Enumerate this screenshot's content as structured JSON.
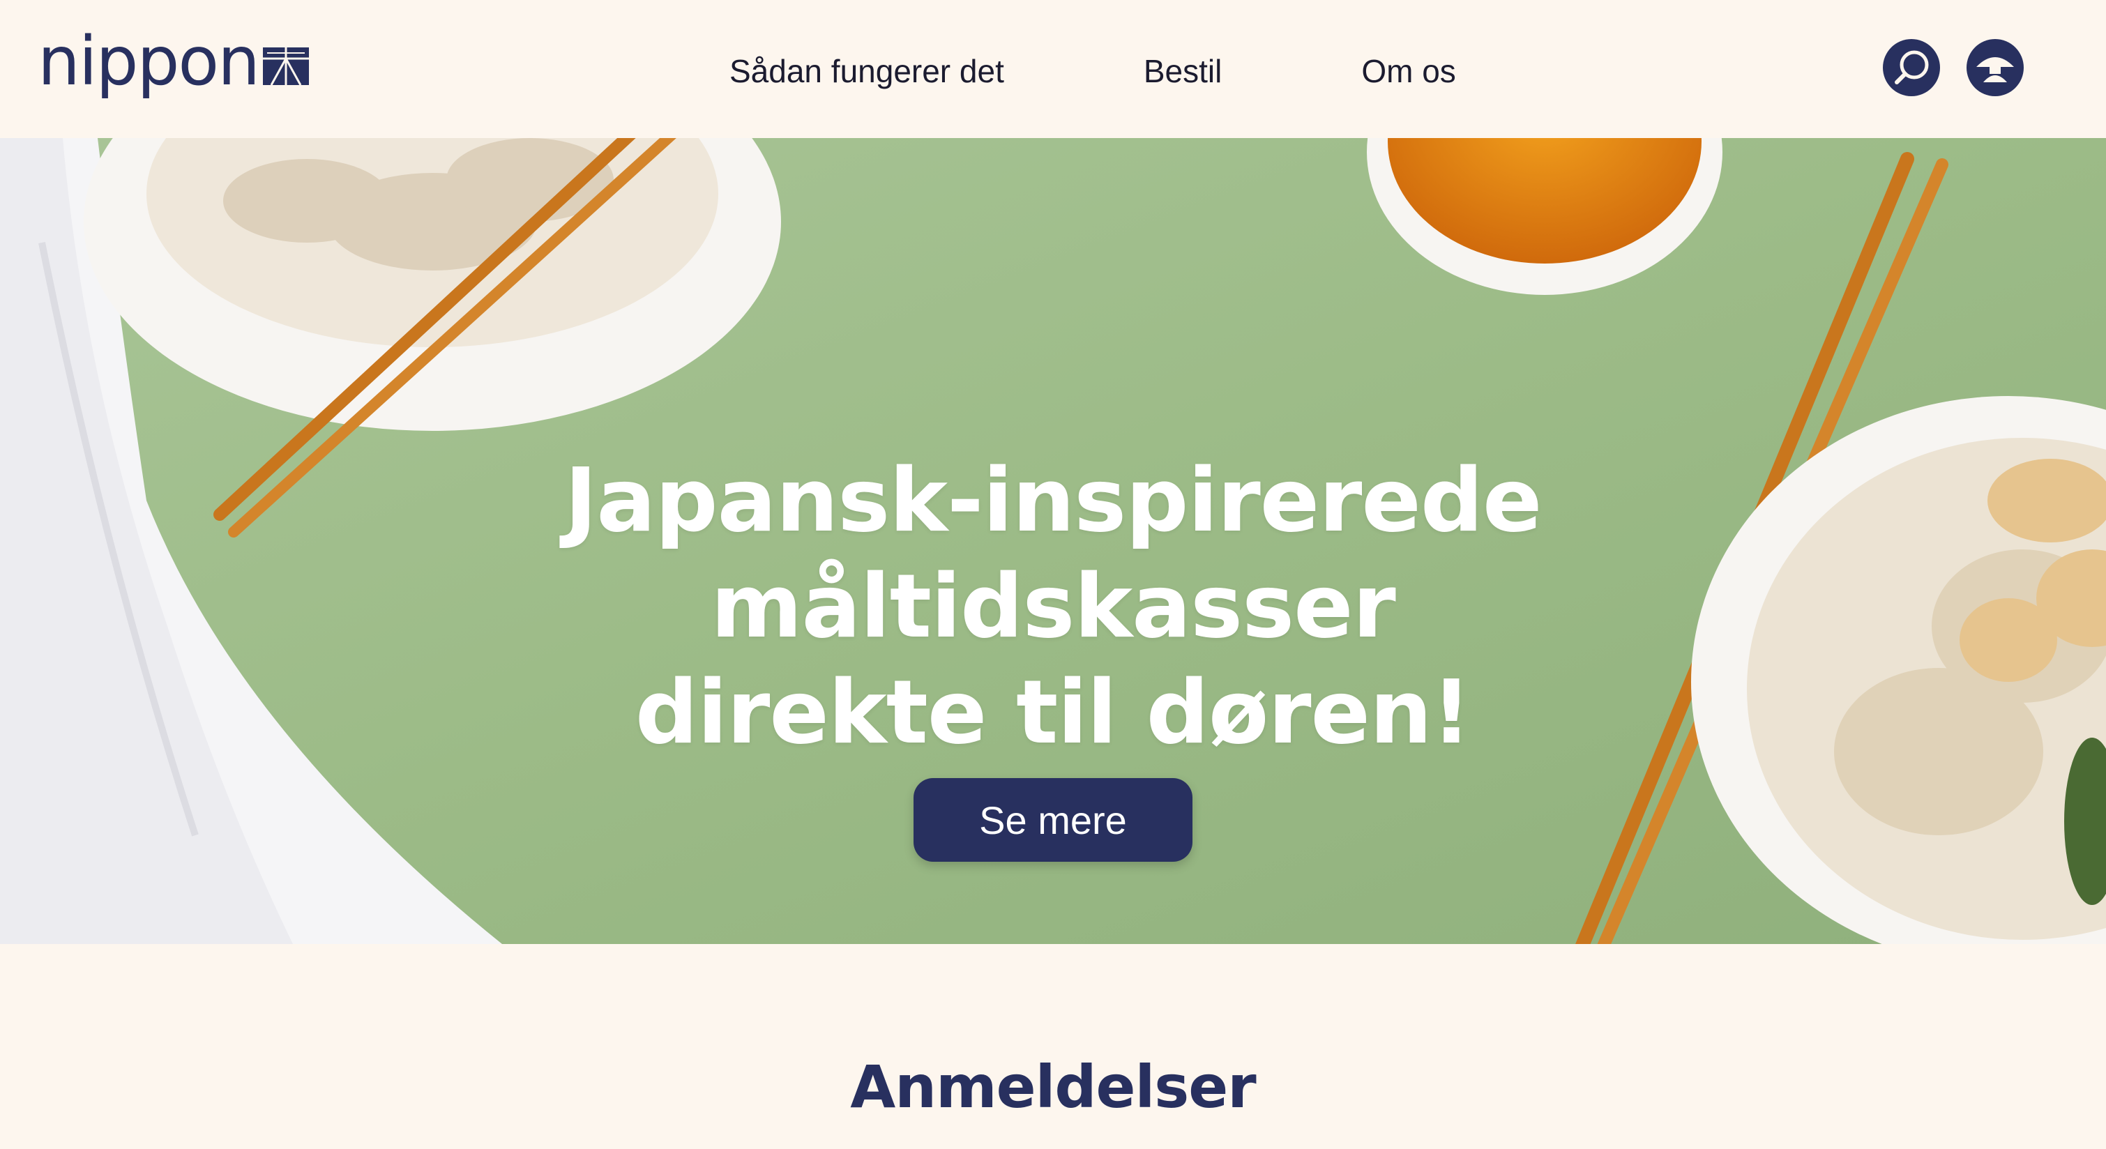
{
  "brand": {
    "name": "nippon",
    "logo_icon": "torii-grid-icon"
  },
  "nav": {
    "items": [
      {
        "label": "Sådan fungerer det"
      },
      {
        "label": "Bestil"
      },
      {
        "label": "Om os"
      }
    ]
  },
  "header_actions": {
    "search_icon": "search-icon",
    "account_icon": "account-icon"
  },
  "hero": {
    "title_lines": [
      "Japansk-inspirerede",
      "måltidskasser",
      "direkte til døren!"
    ],
    "cta_label": "Se mere"
  },
  "reviews": {
    "heading": "Anmeldelser"
  },
  "colors": {
    "brand_navy": "#28305f",
    "page_bg": "#fdf6ee",
    "hero_green": "#9ebc8a"
  }
}
